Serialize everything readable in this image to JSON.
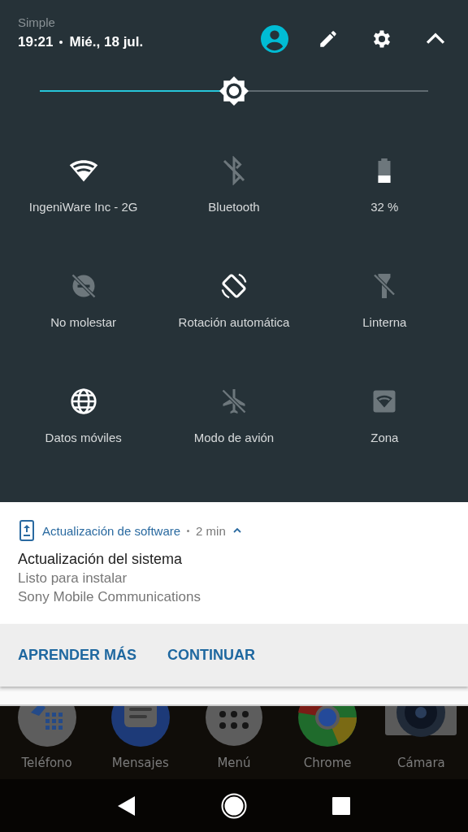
{
  "header": {
    "carrier": "Simple",
    "time": "19:21",
    "date": "Mié., 18 jul."
  },
  "brightness": {
    "level": 0.5
  },
  "tiles": [
    {
      "kind": "wifi",
      "label": "IngeniWare Inc - 2G",
      "on": true
    },
    {
      "kind": "bluetooth",
      "label": "Bluetooth",
      "on": false
    },
    {
      "kind": "battery",
      "label": "32 %",
      "on": false
    },
    {
      "kind": "dnd",
      "label": "No molestar",
      "on": false
    },
    {
      "kind": "rotation",
      "label": "Rotación automática",
      "on": true
    },
    {
      "kind": "flashlight",
      "label": "Linterna",
      "on": false
    },
    {
      "kind": "data",
      "label": "Datos móviles",
      "on": true
    },
    {
      "kind": "airplane",
      "label": "Modo de avión",
      "on": false
    },
    {
      "kind": "hotspot",
      "label": "Zona",
      "on": false
    }
  ],
  "notification": {
    "app": "Actualización de software",
    "time": "2 min",
    "expanded": true,
    "title": "Actualización del sistema",
    "lines": [
      "Listo para instalar",
      "Sony Mobile Communications"
    ],
    "actions": [
      "APRENDER MÁS",
      "CONTINUAR"
    ]
  },
  "dock": [
    {
      "kind": "phone",
      "label": "Teléfono"
    },
    {
      "kind": "messages",
      "label": "Mensajes"
    },
    {
      "kind": "menu",
      "label": "Menú"
    },
    {
      "kind": "browser",
      "label": "Chrome"
    },
    {
      "kind": "camera",
      "label": "Cámara"
    }
  ]
}
